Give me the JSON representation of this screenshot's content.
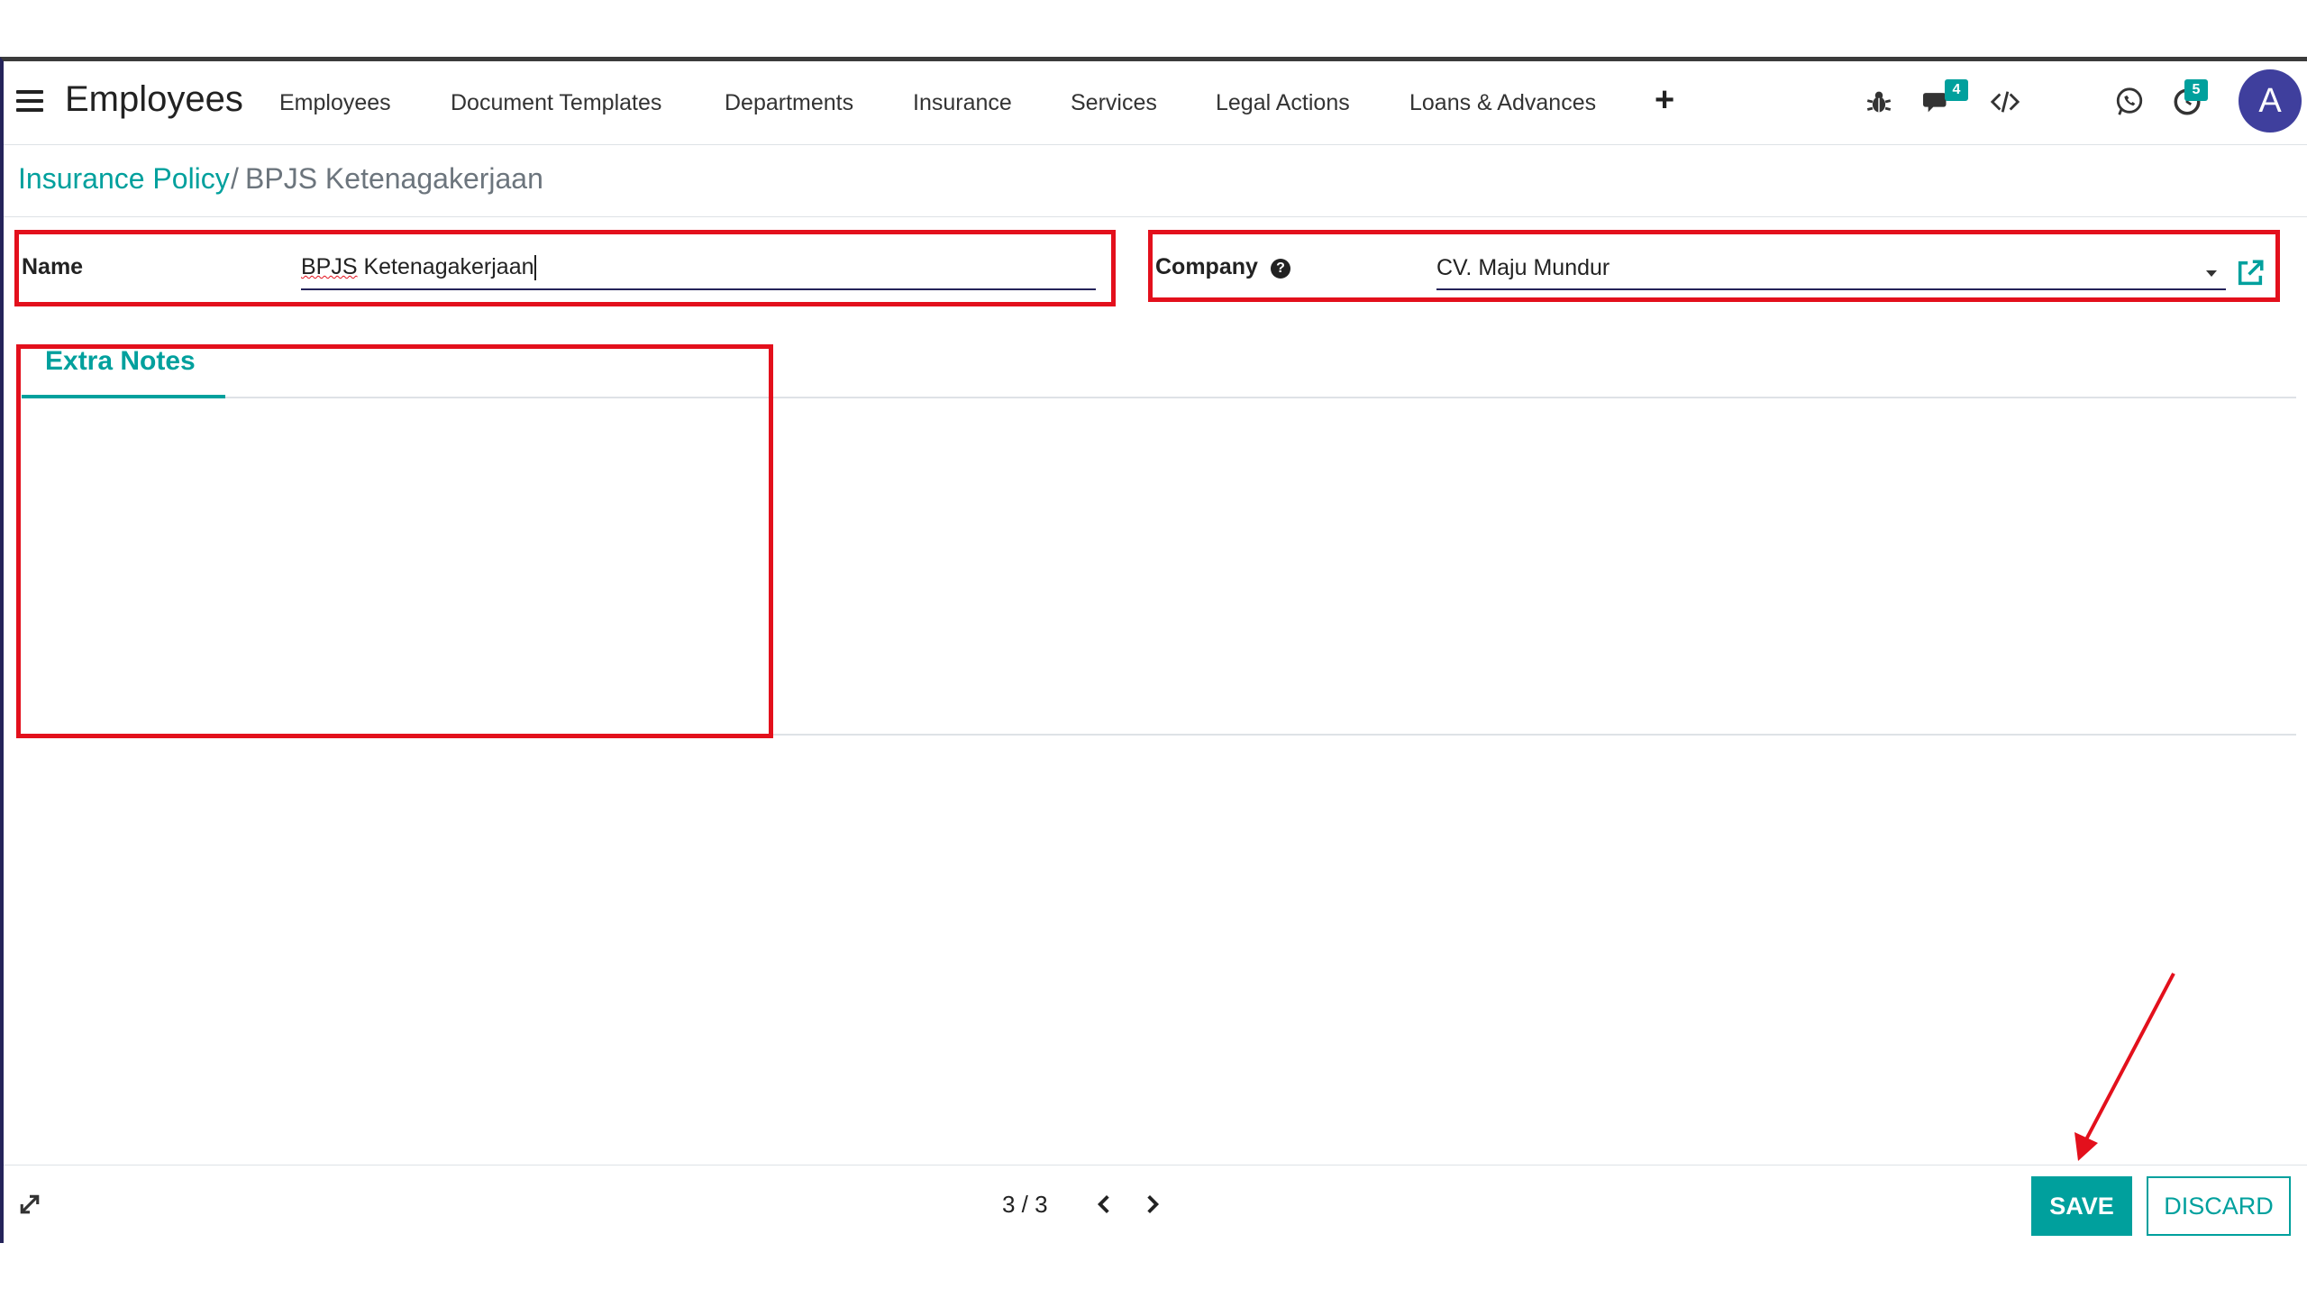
{
  "navbar": {
    "app_name": "Employees",
    "menu": [
      "Employees",
      "Document Templates",
      "Departments",
      "Insurance",
      "Services",
      "Legal Actions",
      "Loans & Advances"
    ],
    "icons": [
      "menu-icon",
      "plus-icon",
      "bug-icon",
      "chat-icon",
      "code-icon",
      "whatsapp-icon",
      "clock-icon"
    ],
    "chat_badge": "4",
    "activity_badge": "5",
    "avatar_initial": "A"
  },
  "breadcrumb": {
    "parent": "Insurance Policy",
    "separator": "/",
    "current": "BPJS Ketenagakerjaan"
  },
  "form": {
    "name_label": "Name",
    "name_value_word1": "BPJS",
    "name_value_rest": " Ketenagakerjaan",
    "company_label": "Company",
    "company_help_glyph": "?",
    "company_value": "CV. Maju Mundur"
  },
  "tabs": {
    "extra_notes": "Extra Notes"
  },
  "footer": {
    "pager": "3 / 3",
    "save": "SAVE",
    "discard": "DISCARD"
  },
  "colors": {
    "accent": "#00a09d",
    "annotation": "#e3101c",
    "avatar": "#3f3f9d"
  }
}
